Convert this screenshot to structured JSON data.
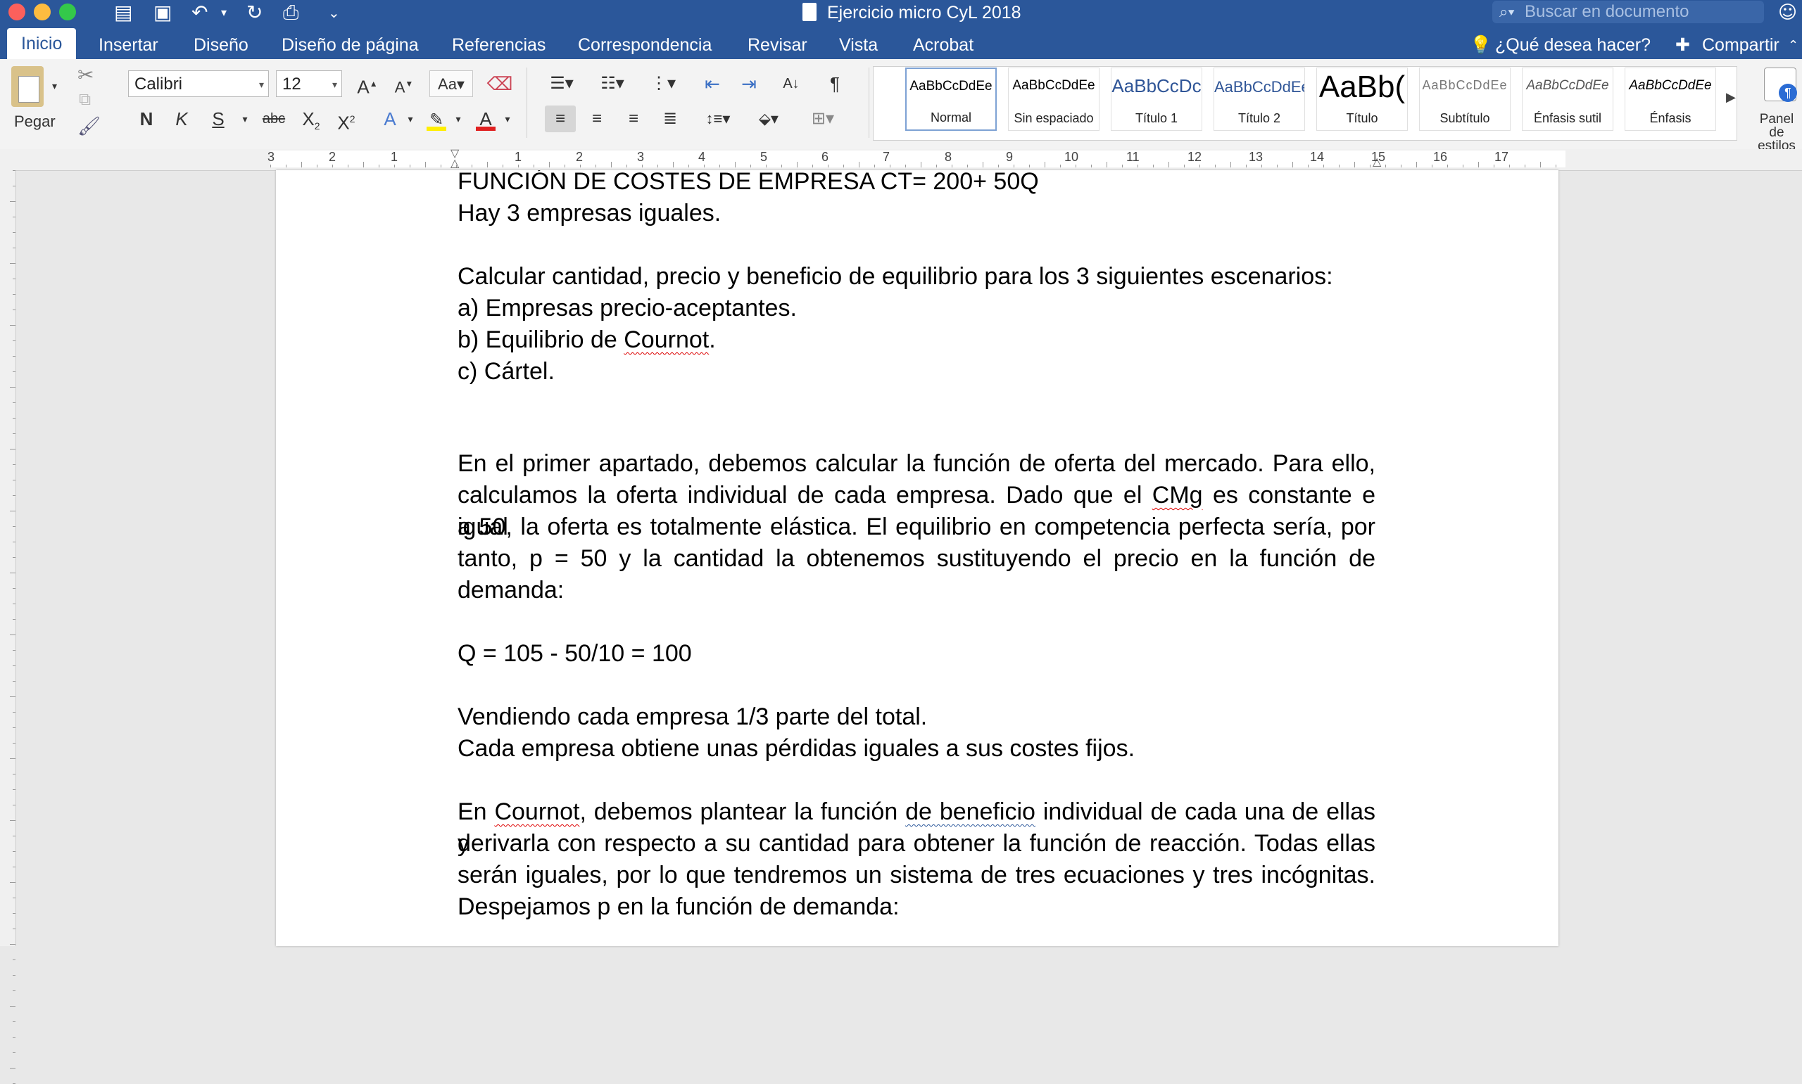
{
  "window": {
    "title": "Ejercicio micro CyL 2018",
    "search_placeholder": "Buscar en documento"
  },
  "tabs": [
    "Inicio",
    "Insertar",
    "Diseño",
    "Diseño de página",
    "Referencias",
    "Correspondencia",
    "Revisar",
    "Vista",
    "Acrobat"
  ],
  "tell_me": "¿Qué desea hacer?",
  "share": "Compartir",
  "ribbon": {
    "paste": "Pegar",
    "font_name": "Calibri",
    "font_size": "12",
    "bold": "N",
    "italic": "K",
    "underline": "S",
    "strikethrough": "abc",
    "styles": [
      {
        "sample": "AaBbCcDdEe",
        "name": "Normal"
      },
      {
        "sample": "AaBbCcDdEe",
        "name": "Sin espaciado"
      },
      {
        "sample": "AaBbCcDc",
        "name": "Título 1"
      },
      {
        "sample": "AaBbCcDdEe",
        "name": "Título 2"
      },
      {
        "sample": "AaBb(",
        "name": "Título"
      },
      {
        "sample": "AaBbCcDdEe",
        "name": "Subtítulo"
      },
      {
        "sample": "AaBbCcDdEe",
        "name": "Énfasis sutil"
      },
      {
        "sample": "AaBbCcDdEe",
        "name": "Énfasis"
      }
    ],
    "styles_pane": "Panel de estilos"
  },
  "ruler": {
    "numbers": [
      "3",
      "2",
      "1",
      "1",
      "2",
      "3",
      "4",
      "5",
      "6",
      "7",
      "8",
      "9",
      "10",
      "11",
      "12",
      "13",
      "14",
      "15",
      "16",
      "17"
    ]
  },
  "document": {
    "l01": "FUNCIÓN DE COSTES DE EMPRESA CT= 200+ 50Q",
    "l02": "Hay 3 empresas iguales.",
    "l03": "Calcular cantidad, precio y beneficio de equilibrio para los 3 siguientes escenarios:",
    "l04": "a) Empresas precio-aceptantes.",
    "l05_a": "b) Equilibrio de ",
    "l05_b": "Cournot",
    "l05_c": ".",
    "l06": "c) Cártel.",
    "p1_l1": "En el primer apartado, debemos calcular la función de oferta del mercado. Para ello,",
    "p1_l2_a": "calculamos la oferta individual de cada empresa. Dado que el ",
    "p1_l2_b": "CMg",
    "p1_l2_c": " es constante e igual",
    "p1_l3": "a 50, la oferta es totalmente elástica. El equilibrio en competencia perfecta sería, por",
    "p1_l4": "tanto, p = 50 y la cantidad la obtenemos sustituyendo el precio en la función de",
    "p1_l5": "demanda:",
    "eq": "Q = 105 - 50/10 = 100",
    "p2_l1": "Vendiendo cada empresa 1/3 parte del total.",
    "p2_l2": "Cada empresa obtiene unas pérdidas iguales a sus costes fijos.",
    "p3_l1_a": "En ",
    "p3_l1_b": "Cournot",
    "p3_l1_c": ", debemos plantear la función ",
    "p3_l1_d": "de  beneficio",
    "p3_l1_e": " individual de cada una de ellas y",
    "p3_l2": "derivarla con respecto a su cantidad para obtener la función de reacción. Todas ellas",
    "p3_l3": "serán iguales, por lo que tendremos un sistema de tres ecuaciones y tres incógnitas.",
    "p3_l4": "Despejamos p en la función de demanda:"
  }
}
